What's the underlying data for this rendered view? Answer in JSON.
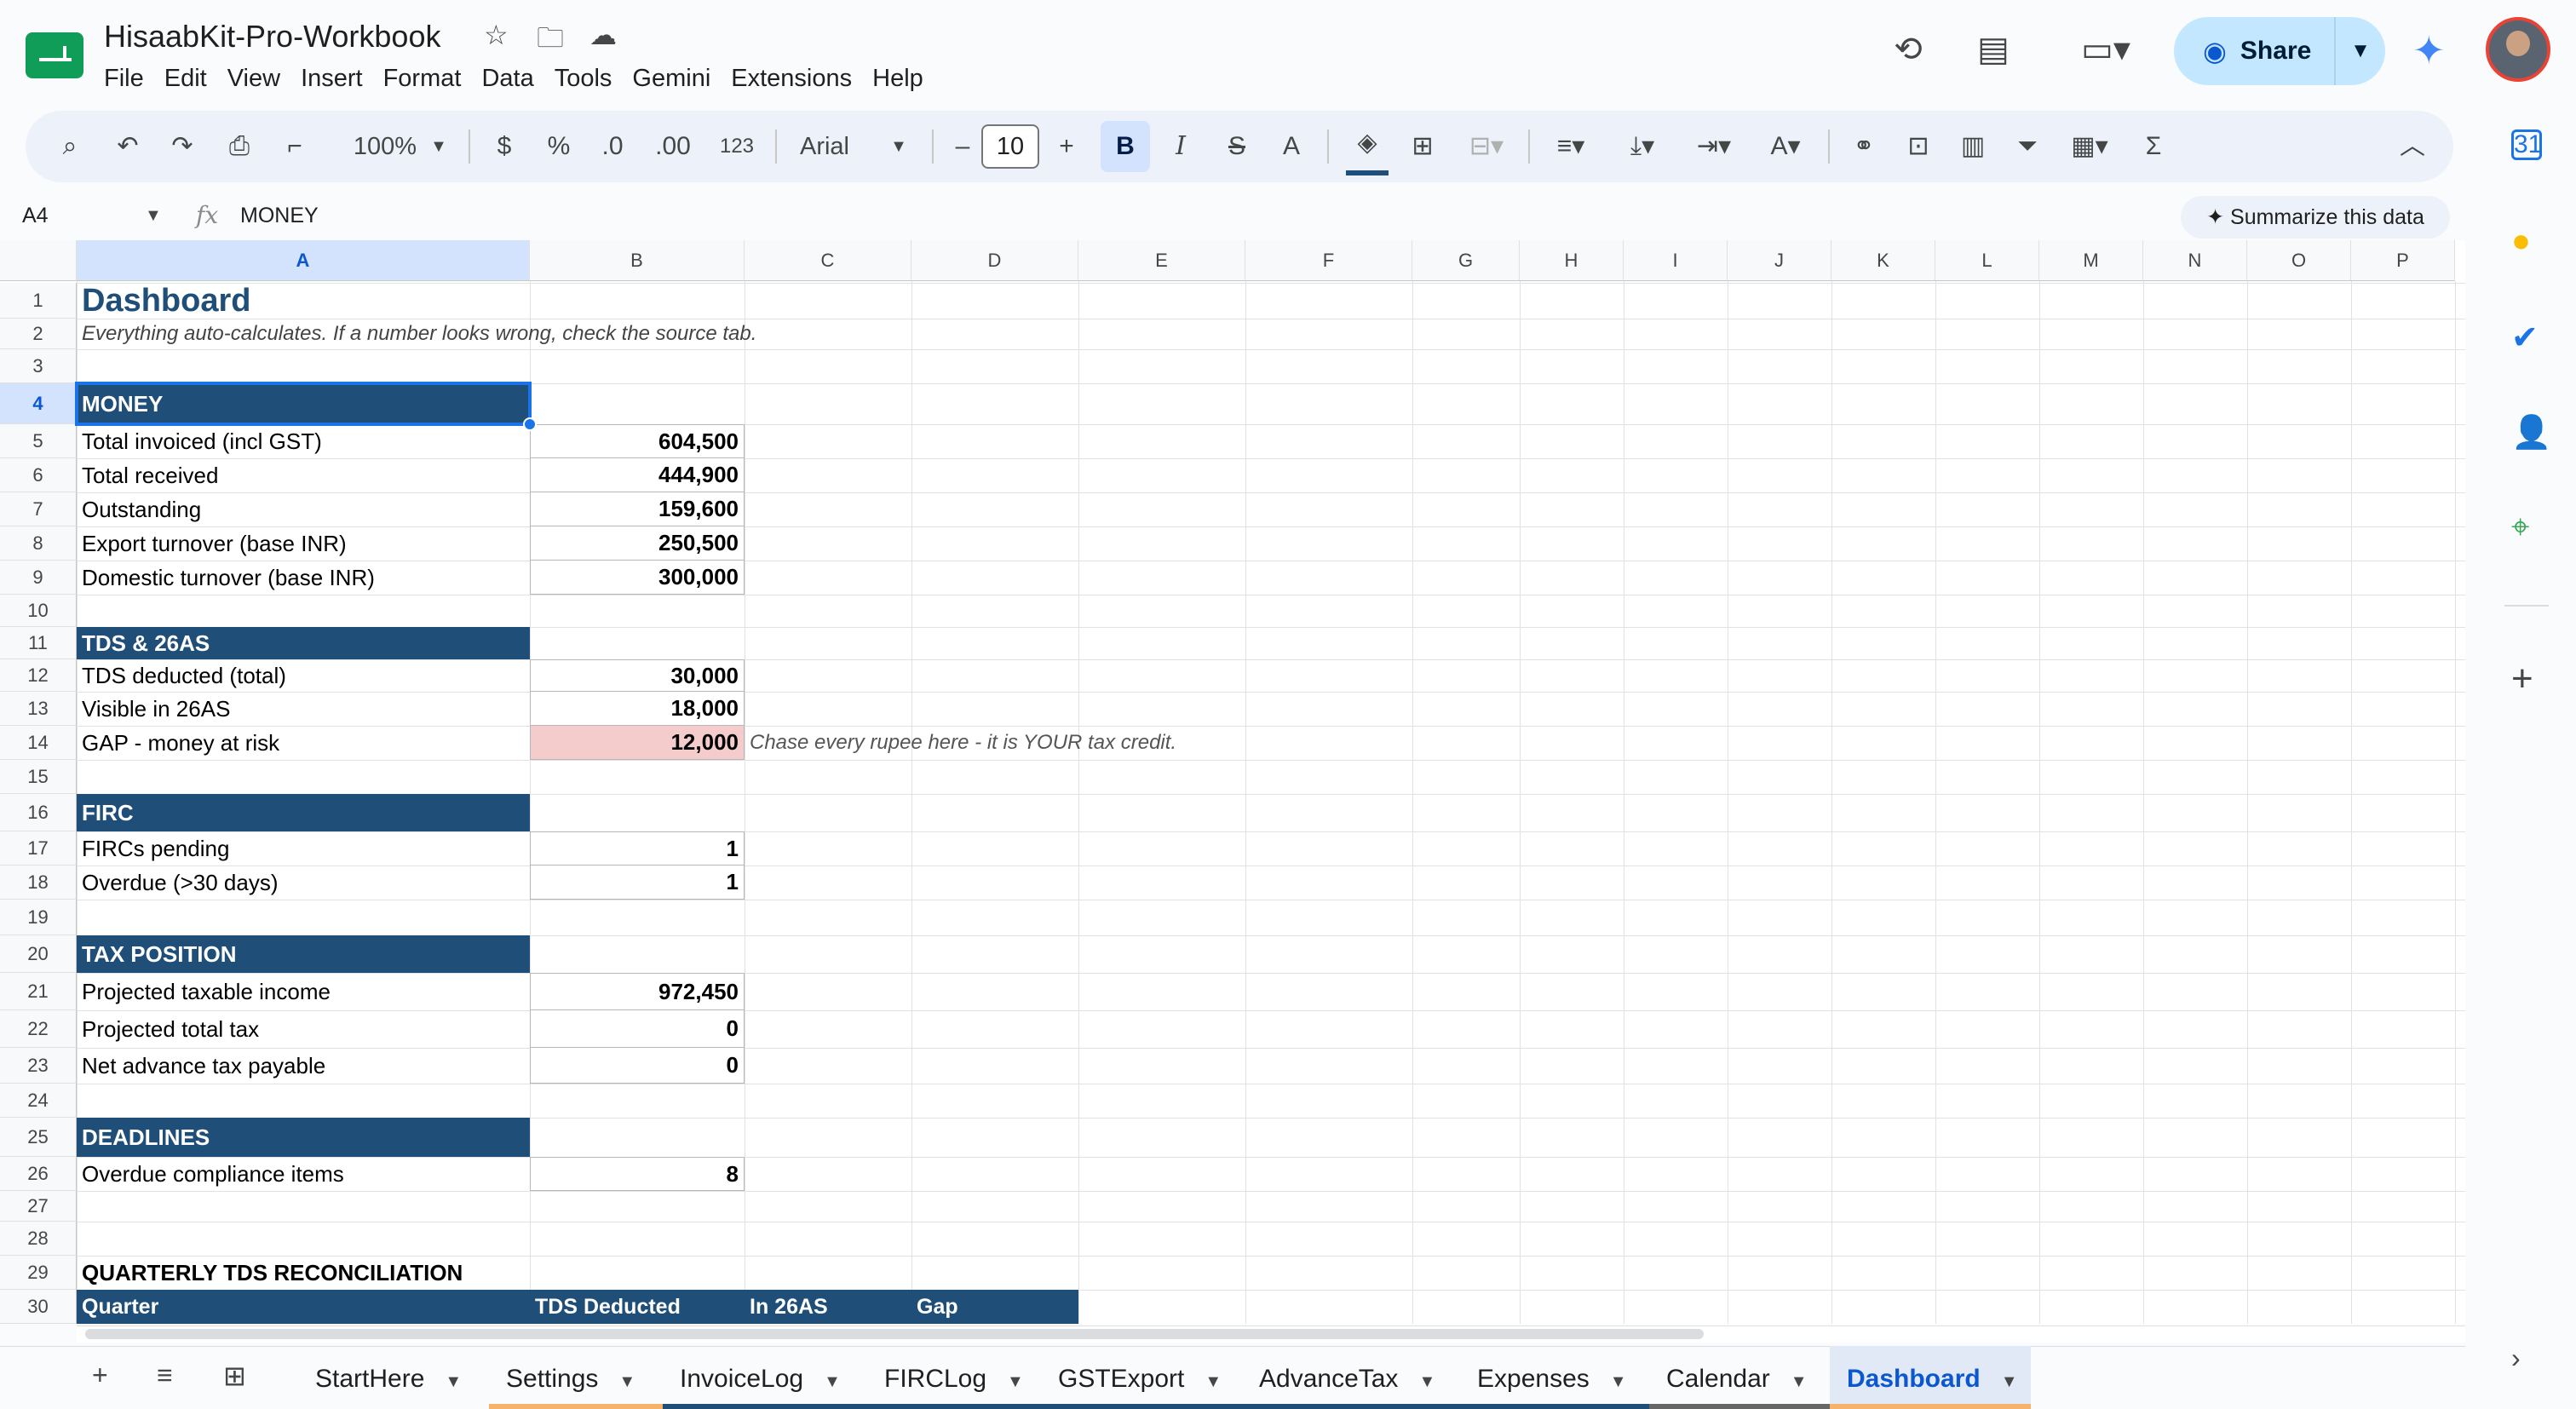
{
  "document": {
    "title": "HisaabKit-Pro-Workbook",
    "menus": [
      "File",
      "Edit",
      "View",
      "Insert",
      "Format",
      "Data",
      "Tools",
      "Gemini",
      "Extensions",
      "Help"
    ]
  },
  "header": {
    "share_label": "Share"
  },
  "toolbar": {
    "zoom": "100%",
    "currency": "$",
    "percent": "%",
    "dec_decrease": ".0",
    "dec_increase": ".00",
    "format_123": "123",
    "font": "Arial",
    "font_size": "10",
    "minus": "–",
    "plus": "+",
    "bold": "B",
    "italic": "I",
    "strike": "S",
    "text_color": "A"
  },
  "formula_bar": {
    "cell_ref": "A4",
    "fx": "fx",
    "value": "MONEY",
    "summarize_label": "Summarize this data"
  },
  "columns": [
    "A",
    "B",
    "C",
    "D",
    "E",
    "F",
    "G",
    "H",
    "I",
    "J",
    "K",
    "L",
    "M",
    "N",
    "O",
    "P"
  ],
  "rows": [
    "1",
    "2",
    "3",
    "4",
    "5",
    "6",
    "7",
    "8",
    "9",
    "10",
    "11",
    "12",
    "13",
    "14",
    "15",
    "16",
    "17",
    "18",
    "19",
    "20",
    "21",
    "22",
    "23",
    "24",
    "25",
    "26",
    "27",
    "28",
    "29",
    "30"
  ],
  "sheet": {
    "title": "Dashboard",
    "subtitle": "Everything auto-calculates. If a number looks wrong, check the source tab.",
    "money": {
      "header": "MONEY",
      "items": [
        {
          "label": "Total invoiced (incl GST)",
          "value": "604,500"
        },
        {
          "label": "Total received",
          "value": "444,900"
        },
        {
          "label": "Outstanding",
          "value": "159,600"
        },
        {
          "label": "Export turnover (base INR)",
          "value": "250,500"
        },
        {
          "label": "Domestic turnover (base INR)",
          "value": "300,000"
        }
      ]
    },
    "tds": {
      "header": "TDS & 26AS",
      "items": [
        {
          "label": "TDS deducted (total)",
          "value": "30,000"
        },
        {
          "label": "Visible in 26AS",
          "value": "18,000"
        },
        {
          "label": "GAP - money at risk",
          "value": "12,000"
        }
      ],
      "note": "Chase every rupee here - it is YOUR tax credit.",
      "gap_color": "#f4cccc"
    },
    "firc": {
      "header": "FIRC",
      "items": [
        {
          "label": "FIRCs pending",
          "value": "1"
        },
        {
          "label": "Overdue (>30 days)",
          "value": "1"
        }
      ]
    },
    "tax": {
      "header": "TAX POSITION",
      "items": [
        {
          "label": "Projected taxable income",
          "value": "972,450"
        },
        {
          "label": "Projected total tax",
          "value": "0"
        },
        {
          "label": "Net advance tax payable",
          "value": "0"
        }
      ]
    },
    "deadlines": {
      "header": "DEADLINES",
      "items": [
        {
          "label": "Overdue compliance items",
          "value": "8"
        }
      ]
    },
    "quarterly": {
      "title": "QUARTERLY TDS RECONCILIATION",
      "headers": [
        "Quarter",
        "TDS Deducted",
        "In 26AS",
        "Gap"
      ]
    }
  },
  "tabs": [
    {
      "label": "StartHere",
      "color": ""
    },
    {
      "label": "Settings",
      "color": "#f6b26b"
    },
    {
      "label": "InvoiceLog",
      "color": "#1f4e79"
    },
    {
      "label": "FIRCLog",
      "color": "#1f4e79"
    },
    {
      "label": "GSTExport",
      "color": "#1f4e79"
    },
    {
      "label": "AdvanceTax",
      "color": "#1f4e79"
    },
    {
      "label": "Expenses",
      "color": "#1f4e79"
    },
    {
      "label": "Calendar",
      "color": "#666666"
    },
    {
      "label": "Dashboard",
      "color": "#f6b26b",
      "active": true
    }
  ],
  "colors": {
    "section_header": "#1f4e79",
    "selection": "#1a73e8",
    "share_bg": "#c2e7ff"
  }
}
